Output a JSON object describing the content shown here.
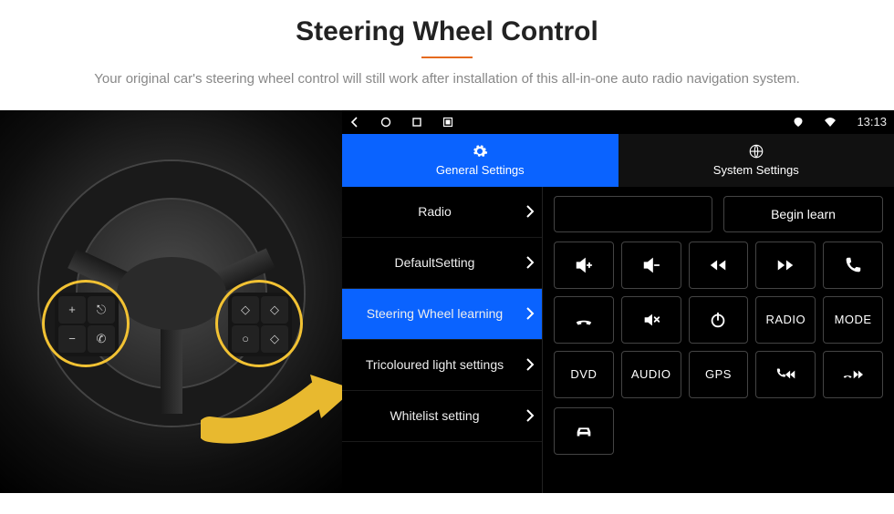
{
  "header": {
    "title": "Steering Wheel Control",
    "subtitle": "Your original car's steering wheel control will still work after installation of this all-in-one auto radio navigation system."
  },
  "statusbar": {
    "time": "13:13"
  },
  "tabs": {
    "general": "General Settings",
    "system": "System Settings"
  },
  "menu": {
    "items": [
      {
        "label": "Radio"
      },
      {
        "label": "DefaultSetting"
      },
      {
        "label": "Steering Wheel learning",
        "active": true
      },
      {
        "label": "Tricoloured light settings"
      },
      {
        "label": "Whitelist setting"
      }
    ]
  },
  "actions": {
    "begin_learn": "Begin learn"
  },
  "buttons": {
    "radio": "RADIO",
    "mode": "MODE",
    "dvd": "DVD",
    "audio": "AUDIO",
    "gps": "GPS"
  },
  "wheel_keys": {
    "plus": "+",
    "minus": "−",
    "voice": "⎋",
    "phone": "✆",
    "up": "◇",
    "down": "◇",
    "left": "○",
    "right": "◇"
  }
}
